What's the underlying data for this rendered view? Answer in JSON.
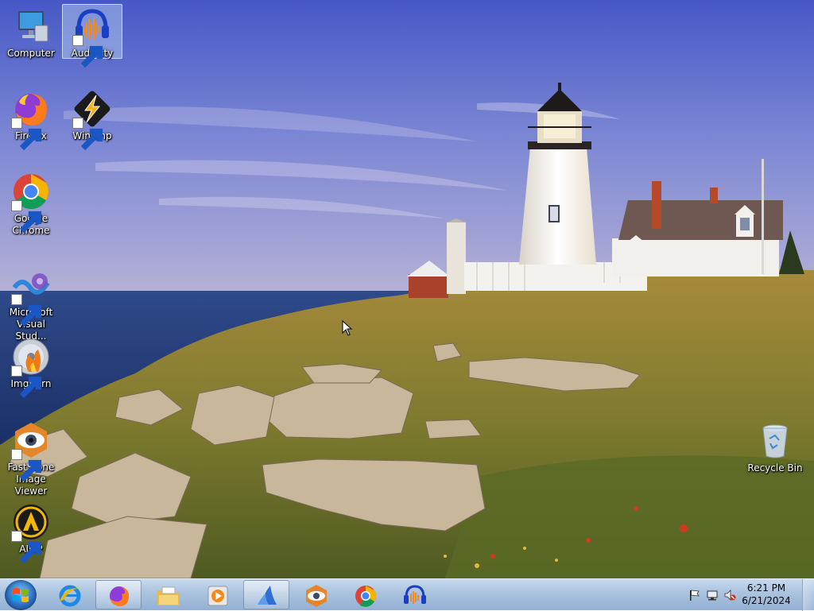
{
  "desktop": {
    "icons": [
      {
        "label": "Computer",
        "icon": "computer-icon",
        "shortcut": false,
        "selected": false
      },
      {
        "label": "Audacity",
        "icon": "audacity-icon",
        "shortcut": true,
        "selected": true
      },
      {
        "label": "Firefox",
        "icon": "firefox-icon",
        "shortcut": true,
        "selected": false
      },
      {
        "label": "Winamp",
        "icon": "winamp-icon",
        "shortcut": true,
        "selected": false
      },
      {
        "label": "Google Chrome",
        "icon": "chrome-icon",
        "shortcut": true,
        "selected": false
      },
      {
        "label": "Microsoft Visual Stud...",
        "icon": "visual-studio-icon",
        "shortcut": true,
        "selected": false
      },
      {
        "label": "ImgBurn",
        "icon": "imgburn-icon",
        "shortcut": true,
        "selected": false
      },
      {
        "label": "FastStone Image Viewer",
        "icon": "faststone-icon",
        "shortcut": true,
        "selected": false
      },
      {
        "label": "AIMP",
        "icon": "aimp-icon",
        "shortcut": true,
        "selected": false
      },
      {
        "label": "Recycle Bin",
        "icon": "recycle-bin-icon",
        "shortcut": false,
        "selected": false
      }
    ]
  },
  "taskbar": {
    "start_icon": "windows-logo-icon",
    "pinned": [
      {
        "icon": "internet-explorer-icon",
        "active": false
      },
      {
        "icon": "firefox-icon",
        "active": true
      },
      {
        "icon": "file-explorer-icon",
        "active": false
      },
      {
        "icon": "media-player-icon",
        "active": false
      },
      {
        "icon": "sail-app-icon",
        "active": true
      },
      {
        "icon": "faststone-icon",
        "active": false
      },
      {
        "icon": "chrome-icon",
        "active": false
      },
      {
        "icon": "audacity-icon",
        "active": false
      }
    ],
    "tray": {
      "icons": [
        "action-center-flag-icon",
        "network-icon",
        "volume-muted-icon"
      ],
      "time": "6:21 PM",
      "date": "6/21/2024"
    }
  },
  "colors": {
    "taskbar_top": "#c7d9ee",
    "taskbar_bottom": "#93b0d3",
    "sky_top": "#4d5ec8",
    "sea": "#223a78"
  }
}
